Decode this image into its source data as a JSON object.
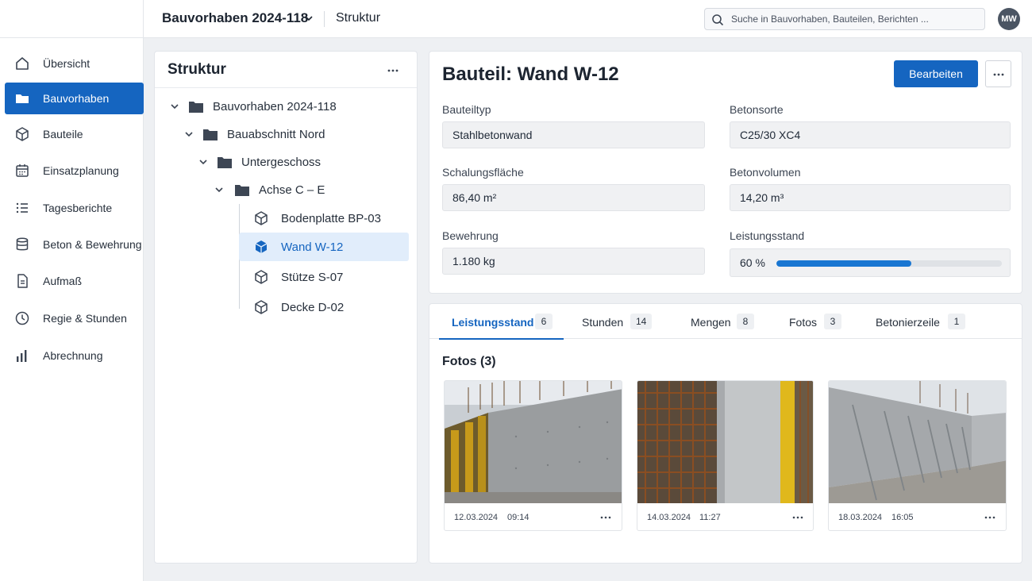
{
  "header": {
    "project_title": "Bauvorhaben 2024-118",
    "section": "Struktur",
    "search_placeholder": "Suche in Bauvorhaben, Bauteilen, Berichten ...",
    "avatar_initials": "MW"
  },
  "sidebar": {
    "items": [
      {
        "label": "Übersicht",
        "icon": "home-icon"
      },
      {
        "label": "Bauvorhaben",
        "icon": "folder-icon",
        "active": true
      },
      {
        "label": "Bauteile",
        "icon": "cube-icon"
      },
      {
        "label": "Einsatzplanung",
        "icon": "calendar-icon"
      },
      {
        "label": "Tagesberichte",
        "icon": "list-icon"
      },
      {
        "label": "Beton & Bewehrung",
        "icon": "database-icon"
      },
      {
        "label": "Aufmaß",
        "icon": "document-icon"
      },
      {
        "label": "Regie & Stunden",
        "icon": "clock-icon"
      },
      {
        "label": "Abrechnung",
        "icon": "bar-chart-icon"
      }
    ]
  },
  "tree": {
    "title": "Struktur",
    "nodes": [
      {
        "label": "Bauvorhaben 2024-118",
        "type": "folder",
        "expanded": true
      },
      {
        "label": "Bauabschnitt Nord",
        "type": "folder",
        "expanded": true
      },
      {
        "label": "Untergeschoss",
        "type": "folder",
        "expanded": true
      },
      {
        "label": "Achse C – E",
        "type": "folder",
        "expanded": true
      },
      {
        "label": "Bodenplatte BP-03",
        "type": "component"
      },
      {
        "label": "Wand W-12",
        "type": "component",
        "selected": true
      },
      {
        "label": "Stütze S-07",
        "type": "component"
      },
      {
        "label": "Decke D-02",
        "type": "component"
      }
    ]
  },
  "detail": {
    "title": "Bauteil: Wand W-12",
    "edit_label": "Bearbeiten",
    "fields": {
      "bauteiltyp": {
        "label": "Bauteiltyp",
        "value": "Stahlbetonwand"
      },
      "betonsorte": {
        "label": "Betonsorte",
        "value": "C25/30 XC4"
      },
      "schalungsflaeche": {
        "label": "Schalungsfläche",
        "value": "86,40 m²"
      },
      "betonvolumen": {
        "label": "Betonvolumen",
        "value": "14,20 m³"
      },
      "bewehrung": {
        "label": "Bewehrung",
        "value": "1.180 kg"
      },
      "leistungsstand": {
        "label": "Leistungsstand",
        "value": "60 %",
        "progress": 0.6
      }
    }
  },
  "tabs": [
    {
      "label": "Leistungsstand",
      "count": "6",
      "active": true
    },
    {
      "label": "Stunden",
      "count": "14"
    },
    {
      "label": "Mengen",
      "count": "8"
    },
    {
      "label": "Fotos",
      "count": "3"
    },
    {
      "label": "Betonierzeile",
      "count": "1"
    }
  ],
  "photos": {
    "title": "Fotos (3)",
    "items": [
      {
        "date": "12.03.2024",
        "time": "09:14"
      },
      {
        "date": "14.03.2024",
        "time": "11:27"
      },
      {
        "date": "18.03.2024",
        "time": "16:05"
      }
    ]
  },
  "colors": {
    "accent": "#1565c0",
    "progress": "#1976d2",
    "selected_row": "#e1edfb"
  }
}
